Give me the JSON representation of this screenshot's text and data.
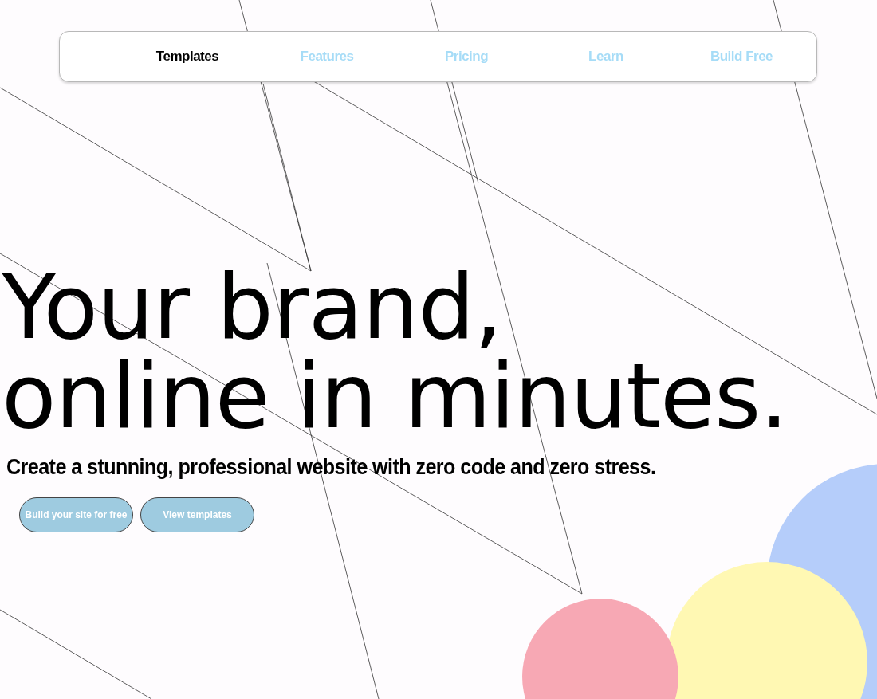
{
  "nav": {
    "items": [
      {
        "label": "Templates",
        "selected": true
      },
      {
        "label": "Features",
        "selected": false
      },
      {
        "label": "Pricing",
        "selected": false
      },
      {
        "label": "Learn",
        "selected": false
      },
      {
        "label": "Build Free",
        "selected": false
      }
    ]
  },
  "hero": {
    "headline_lines": [
      "Your brand,",
      "online in minutes."
    ],
    "subtitle": "Create a stunning, professional website with zero code and zero stress.",
    "buttons": [
      "Build your site for free",
      "View templates"
    ]
  },
  "decor": {
    "circles": [
      {
        "color": "#b5cdfa"
      },
      {
        "color": "#fff8b3"
      },
      {
        "color": "#f7a8b4"
      }
    ]
  }
}
